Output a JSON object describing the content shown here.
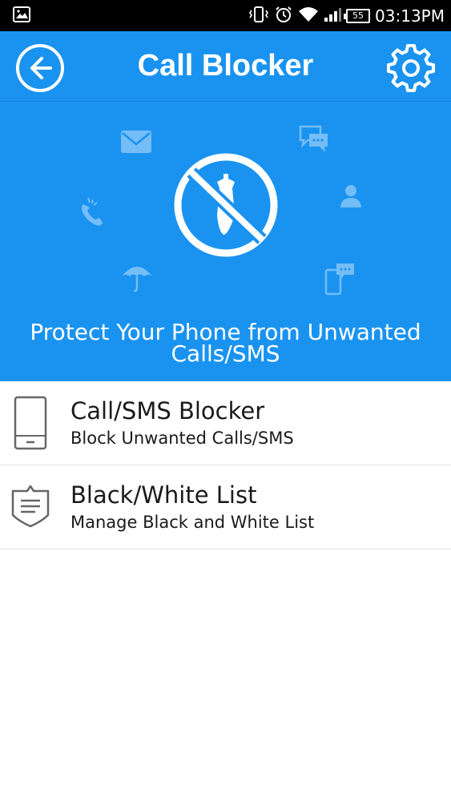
{
  "status_bar": {
    "time": "03:13PM",
    "battery": "55",
    "icons": [
      "gallery-icon",
      "vibrate-icon",
      "alarm-icon",
      "wifi-icon",
      "signal-icon",
      "battery-icon"
    ]
  },
  "header": {
    "title": "Call Blocker",
    "back_icon": "back-arrow-icon",
    "settings_icon": "gear-icon"
  },
  "hero": {
    "tagline": "Protect Your Phone from Unwanted Calls/SMS",
    "main_icon": "block-icon",
    "decor_icons": [
      "envelope-icon",
      "chat-icon",
      "phone-call-icon",
      "contact-icon",
      "umbrella-icon",
      "phone-message-icon"
    ]
  },
  "list": {
    "items": [
      {
        "title": "Call/SMS Blocker",
        "subtitle": "Block Unwanted Calls/SMS",
        "icon": "phone-icon"
      },
      {
        "title": "Black/White List",
        "subtitle": "Manage Black and White List",
        "icon": "shield-list-icon"
      }
    ]
  },
  "colors": {
    "primary": "#1a93f0",
    "status_bar": "#000000",
    "text": "#1a1a1a",
    "divider": "#e3e3e3"
  }
}
